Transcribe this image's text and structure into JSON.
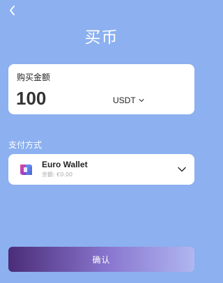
{
  "header": {
    "title": "买币",
    "back_icon": "chevron-left-icon"
  },
  "amount": {
    "label": "购买金额",
    "value": "100",
    "currency": "USDT"
  },
  "payment": {
    "label": "支付方式",
    "wallet_name": "Euro Wallet",
    "wallet_balance": "余额: €0.00"
  },
  "confirm_label": "确认",
  "colors": {
    "background": "#8cb0f0",
    "button_start": "#4b2c78",
    "button_end": "#b0b6f0"
  }
}
